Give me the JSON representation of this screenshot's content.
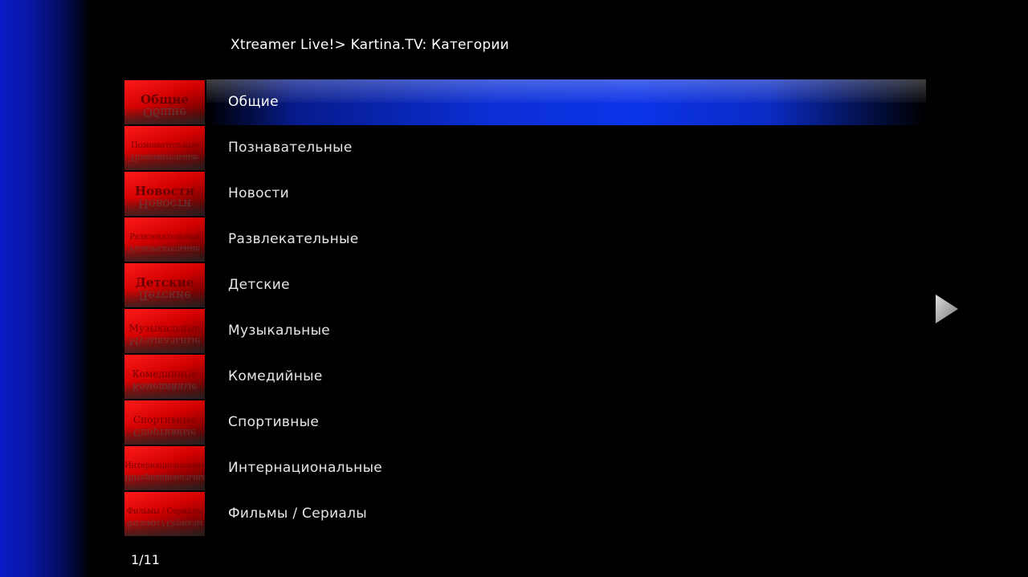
{
  "breadcrumb": {
    "path": "Xtreamer Live!> Kartina.TV: ",
    "current": "Категории"
  },
  "menu": {
    "selected_index": 0,
    "items": [
      {
        "label": "Общие",
        "thumb_text": "Общие",
        "thumb_style": "big"
      },
      {
        "label": "Познавательные",
        "thumb_text": "Познавательные",
        "thumb_style": "small"
      },
      {
        "label": "Новости",
        "thumb_text": "Новости",
        "thumb_style": "big"
      },
      {
        "label": "Развлекательные",
        "thumb_text": "Развлекательные",
        "thumb_style": "small"
      },
      {
        "label": "Детские",
        "thumb_text": "Детские",
        "thumb_style": "big"
      },
      {
        "label": "Музыкальные",
        "thumb_text": "Музыкальные",
        "thumb_style": "normal"
      },
      {
        "label": "Комедийные",
        "thumb_text": "Комедийные",
        "thumb_style": "normal"
      },
      {
        "label": "Спортивные",
        "thumb_text": "Спортивные",
        "thumb_style": "normal"
      },
      {
        "label": "Интернациональные",
        "thumb_text": "Интернациональные",
        "thumb_style": "small"
      },
      {
        "label": "Фильмы / Сериалы",
        "thumb_text": "Фильмы / Сериалы",
        "thumb_style": "small"
      }
    ]
  },
  "pager": {
    "text": "1/11"
  },
  "icons": {
    "next": "play-arrow-icon"
  },
  "colors": {
    "accent": "#0b33e8",
    "thumb_red": "#e00000",
    "left_gradient": "#0a1cc8"
  }
}
